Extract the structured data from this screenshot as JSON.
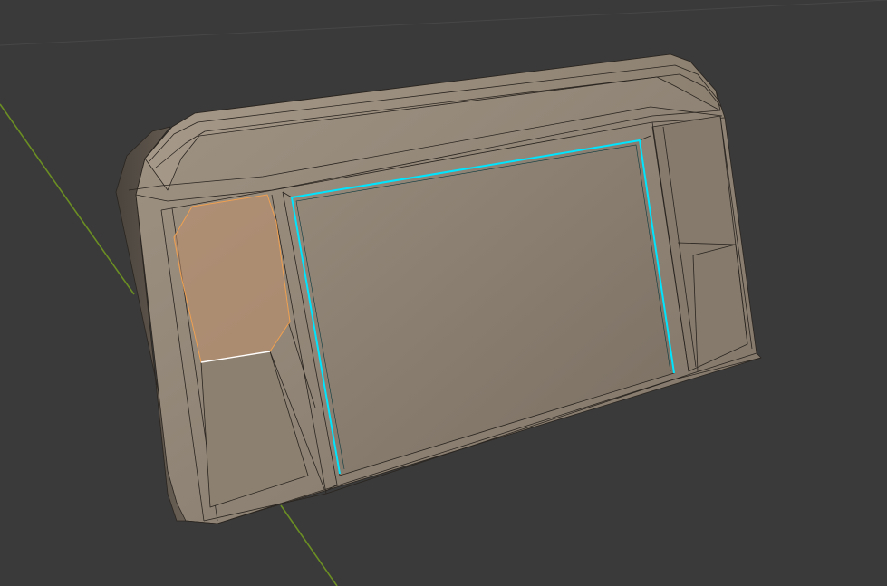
{
  "viewport": {
    "background": "#3a3a3a",
    "grid_color": "#454545",
    "axis_y_color": "#6b8e23"
  },
  "mesh": {
    "base_color": "#8f8373",
    "edge_color": "#2a2520",
    "selected_face_color": "#c7906a",
    "selected_face_outline": "#f0a050",
    "selected_edge_color": "#00e5ff",
    "active_edge_color": "#ffffff"
  }
}
